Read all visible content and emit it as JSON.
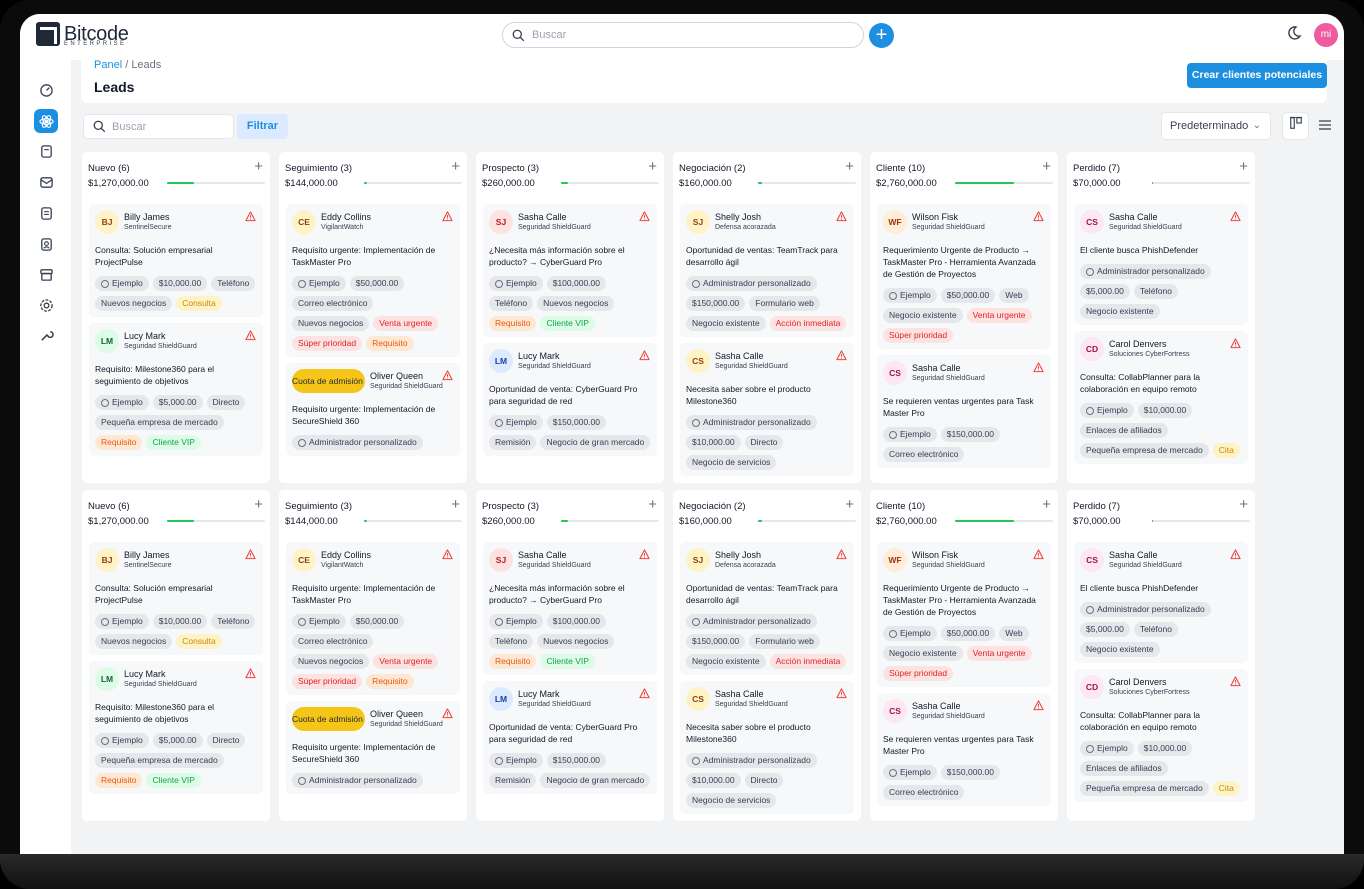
{
  "app": {
    "brand": "Bitcode",
    "brand_sub": "ENTERPRISE",
    "search_placeholder": "Buscar",
    "avatar_initials": "mi"
  },
  "header": {
    "breadcrumb_root": "Panel",
    "breadcrumb_sep": " / ",
    "breadcrumb_current": "Leads",
    "title": "Leads",
    "create_label": "Crear clientes potenciales"
  },
  "toolbar": {
    "search_placeholder": "Buscar",
    "filter_label": "Filtrar",
    "sort_value": "Predeterminado"
  },
  "colors": {
    "accent": "#1d8fe0",
    "progress": "#22c55e",
    "warning": "#ef4444"
  },
  "sidebar": [
    "dashboard-icon",
    "leads-icon",
    "notes-icon",
    "mail-icon",
    "tasks-icon",
    "contacts-icon",
    "archive-icon",
    "settings-icon",
    "tools-icon"
  ],
  "columns": [
    {
      "title": "Nuevo (6)",
      "amount": "$1,270,000.00",
      "progress": 0.28,
      "cards": [
        {
          "initials": "BJ",
          "avcolor": "yellow",
          "name": "Billy James",
          "company": "SentinelSecure",
          "title": "Consulta: Solución empresarial ProjectPulse",
          "tags": [
            {
              "t": "Ejemplo",
              "u": true
            },
            {
              "t": "$10,000.00"
            },
            {
              "t": "Teléfono"
            },
            {
              "t": "Nuevos negocios"
            },
            {
              "t": "Consulta",
              "c": "yellow"
            }
          ]
        },
        {
          "initials": "LM",
          "avcolor": "green",
          "name": "Lucy Mark",
          "company": "Seguridad ShieldGuard",
          "title": "Requisito: Milestone360 para el seguimiento de objetivos",
          "tags": [
            {
              "t": "Ejemplo",
              "u": true
            },
            {
              "t": "$5,000.00"
            },
            {
              "t": "Directo"
            },
            {
              "t": "Pequeña empresa de mercado"
            },
            {
              "t": "Requisito",
              "c": "orange"
            },
            {
              "t": "Cliente VIP",
              "c": "green"
            }
          ]
        }
      ]
    },
    {
      "title": "Seguimiento (3)",
      "amount": "$144,000.00",
      "progress": 0.03,
      "cards": [
        {
          "initials": "CE",
          "avcolor": "yellow",
          "name": "Eddy Collins",
          "company": "VigilantWatch",
          "title": "Requisito urgente: Implementación de TaskMaster Pro",
          "tags": [
            {
              "t": "Ejemplo",
              "u": true
            },
            {
              "t": "$50,000.00"
            },
            {
              "t": "Correo electrónico"
            },
            {
              "t": "Nuevos negocios"
            },
            {
              "t": "Venta urgente",
              "c": "red"
            },
            {
              "t": "Súper prioridad",
              "c": "red"
            },
            {
              "t": "Requisito",
              "c": "orange"
            }
          ]
        },
        {
          "initials": "Cuota de admisión",
          "avcolor": "pill",
          "name": "Oliver Queen",
          "company": "Seguridad ShieldGuard",
          "title": "Requisito urgente: Implementación de SecureShield 360",
          "tags": [
            {
              "t": "Administrador personalizado",
              "u": true
            }
          ]
        }
      ]
    },
    {
      "title": "Prospecto (3)",
      "amount": "$260,000.00",
      "progress": 0.07,
      "cards": [
        {
          "initials": "SJ",
          "avcolor": "red",
          "name": "Sasha Calle",
          "company": "Seguridad ShieldGuard",
          "title": "¿Necesita más información sobre el producto? → CyberGuard Pro",
          "tags": [
            {
              "t": "Ejemplo",
              "u": true
            },
            {
              "t": "$100,000.00"
            },
            {
              "t": "Teléfono"
            },
            {
              "t": "Nuevos negocios"
            },
            {
              "t": "Requisito",
              "c": "orange"
            },
            {
              "t": "Cliente VIP",
              "c": "green"
            }
          ]
        },
        {
          "initials": "LM",
          "avcolor": "blue",
          "name": "Lucy Mark",
          "company": "Seguridad ShieldGuard",
          "title": "Oportunidad de venta: CyberGuard Pro para seguridad de red",
          "tags": [
            {
              "t": "Ejemplo",
              "u": true
            },
            {
              "t": "$150,000.00"
            },
            {
              "t": "Remisión"
            },
            {
              "t": "Negocio de gran mercado"
            }
          ]
        }
      ]
    },
    {
      "title": "Negociación (2)",
      "amount": "$160,000.00",
      "progress": 0.04,
      "cards": [
        {
          "initials": "SJ",
          "avcolor": "yellow",
          "name": "Shelly Josh",
          "company": "Defensa acorazada",
          "title": "Oportunidad de ventas: TeamTrack para desarrollo ágil",
          "tags": [
            {
              "t": "Administrador personalizado",
              "u": true
            },
            {
              "t": "$150,000.00"
            },
            {
              "t": "Formulario web"
            },
            {
              "t": "Negocio existente"
            },
            {
              "t": "Acción inmediata",
              "c": "red"
            }
          ]
        },
        {
          "initials": "CS",
          "avcolor": "yellow",
          "name": "Sasha Calle",
          "company": "Seguridad ShieldGuard",
          "title": "Necesita saber sobre el producto Milestone360",
          "tags": [
            {
              "t": "Administrador personalizado",
              "u": true
            },
            {
              "t": "$10,000.00"
            },
            {
              "t": "Directo"
            },
            {
              "t": "Negocio de servicios"
            }
          ]
        }
      ]
    },
    {
      "title": "Cliente (10)",
      "amount": "$2,760,000.00",
      "progress": 0.6,
      "cards": [
        {
          "initials": "WF",
          "avcolor": "orange",
          "name": "Wilson Fisk",
          "company": "Seguridad ShieldGuard",
          "title": "Requerimiento Urgente de Producto → TaskMaster Pro - Herramienta Avanzada de Gestión de Proyectos",
          "tags": [
            {
              "t": "Ejemplo",
              "u": true
            },
            {
              "t": "$50,000.00"
            },
            {
              "t": "Web"
            },
            {
              "t": "Negocio existente"
            },
            {
              "t": "Venta urgente",
              "c": "red"
            },
            {
              "t": "Súper prioridad",
              "c": "red"
            }
          ]
        },
        {
          "initials": "CS",
          "avcolor": "pink",
          "name": "Sasha Calle",
          "company": "Seguridad ShieldGuard",
          "title": "Se requieren ventas urgentes para Task Master Pro",
          "tags": [
            {
              "t": "Ejemplo",
              "u": true
            },
            {
              "t": "$150,000.00"
            },
            {
              "t": "Correo electrónico"
            }
          ]
        }
      ]
    },
    {
      "title": "Perdido (7)",
      "amount": "$70,000.00",
      "progress": 0.01,
      "cards": [
        {
          "initials": "CS",
          "avcolor": "pink",
          "name": "Sasha Calle",
          "company": "Seguridad ShieldGuard",
          "title": "El cliente busca PhishDefender",
          "tags": [
            {
              "t": "Administrador personalizado",
              "u": true
            },
            {
              "t": "$5,000.00"
            },
            {
              "t": "Teléfono"
            },
            {
              "t": "Negocio existente"
            }
          ]
        },
        {
          "initials": "CD",
          "avcolor": "pink",
          "name": "Carol Denvers",
          "company": "Soluciones CyberFortress",
          "title": "Consulta: CollabPlanner para la colaboración en equipo remoto",
          "tags": [
            {
              "t": "Ejemplo",
              "u": true
            },
            {
              "t": "$10,000.00"
            },
            {
              "t": "Enlaces de afiliados"
            },
            {
              "t": "Pequeña empresa de mercado"
            },
            {
              "t": "Cita",
              "c": "yellow"
            }
          ]
        }
      ]
    }
  ]
}
